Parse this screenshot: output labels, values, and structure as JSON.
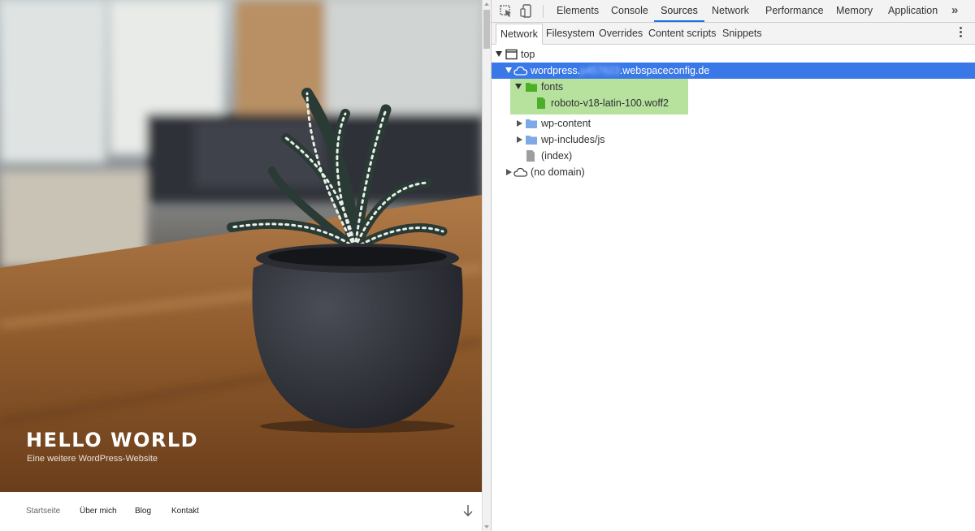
{
  "website": {
    "hero_title": "HELLO WORLD",
    "hero_subtitle": "Eine weitere WordPress-Website",
    "nav": [
      {
        "label": "Startseite"
      },
      {
        "label": "Über mich"
      },
      {
        "label": "Blog"
      },
      {
        "label": "Kontakt"
      }
    ],
    "scroll_down_icon": "arrow-down-icon"
  },
  "devtools": {
    "main_tabs": [
      {
        "label": "Elements"
      },
      {
        "label": "Console"
      },
      {
        "label": "Sources",
        "selected": true
      },
      {
        "label": "Network"
      },
      {
        "label": "Performance"
      },
      {
        "label": "Memory"
      },
      {
        "label": "Application"
      }
    ],
    "more_tabs_glyph": "»",
    "sub_tabs": [
      {
        "label": "Network",
        "selected": true
      },
      {
        "label": "Filesystem"
      },
      {
        "label": "Overrides"
      },
      {
        "label": "Content scripts"
      },
      {
        "label": "Snippets"
      }
    ],
    "tree": {
      "top": "top",
      "domain_prefix": "wordpress.",
      "domain_hidden": "p457623",
      "domain_suffix": ".webspaceconfig.de",
      "fonts_folder": "fonts",
      "font_file": "roboto-v18-latin-100.woff2",
      "wp_content": "wp-content",
      "wp_includes": "wp-includes/js",
      "index": "(index)",
      "no_domain": "(no domain)"
    },
    "colors": {
      "selected_row": "#3b78e7",
      "highlight": "#b6e29e",
      "folder_blue": "#7fa8e6",
      "folder_green": "#4caf28"
    }
  }
}
